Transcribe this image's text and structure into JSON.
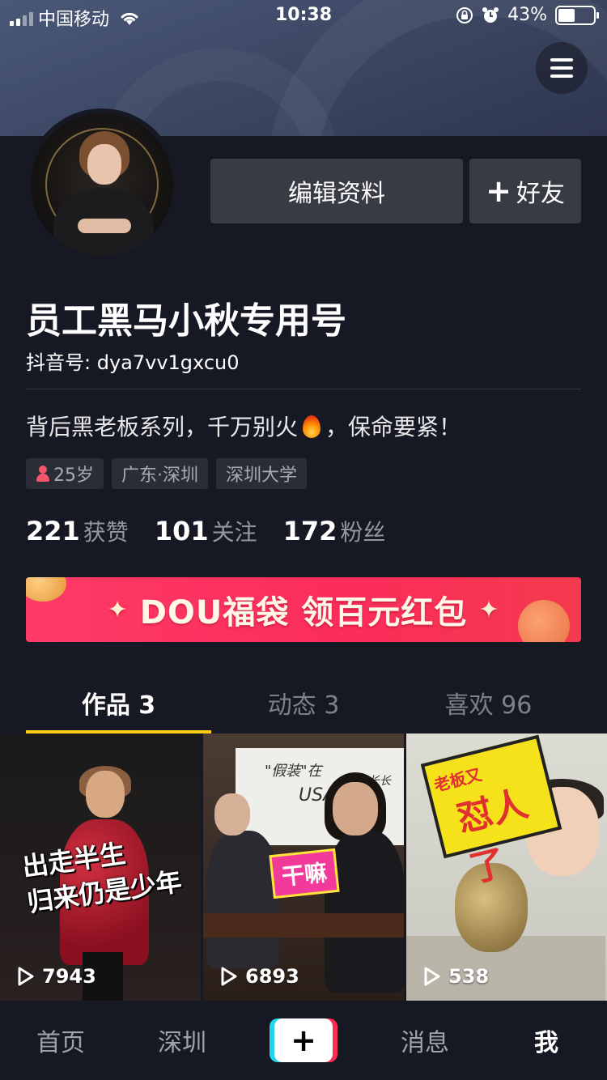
{
  "status_bar": {
    "carrier": "中国移动",
    "time": "10:38",
    "battery_percent": "43%",
    "battery_level": 0.43
  },
  "profile": {
    "edit_label": "编辑资料",
    "add_friend_label": "好友",
    "name": "员工黑马小秋专用号",
    "douyin_id": "抖音号: dya7vv1gxcu0",
    "bio_before": "背后黑老板系列，千万别火",
    "bio_after": "，保命要紧！",
    "tags": {
      "age": "25岁",
      "location": "广东·深圳",
      "school": "深圳大学"
    },
    "stats": {
      "likes_num": "221",
      "likes_label": "获赞",
      "following_num": "101",
      "following_label": "关注",
      "followers_num": "172",
      "followers_label": "粉丝"
    }
  },
  "promo": {
    "text": "DOU福袋  领百元红包",
    "accent_color": "#fe2c55"
  },
  "tabs": {
    "works": "作品 3",
    "moments": "动态 3",
    "likes": "喜欢 96",
    "active_color": "#face15"
  },
  "videos": [
    {
      "plays": "7943",
      "caption_line1": "出走半生",
      "caption_line2": "归来仍是少年"
    },
    {
      "plays": "6893",
      "sticker": "干嘛",
      "board_text1": "\"假装\"在",
      "board_text2": "USA",
      "board_text3": "超长长长"
    },
    {
      "plays": "538",
      "sign_small": "老板又",
      "sign_big": "怼人了"
    }
  ],
  "nav": {
    "home": "首页",
    "city": "深圳",
    "create": "+",
    "messages": "消息",
    "me": "我"
  },
  "icons": {
    "signal": "signal-icon",
    "wifi": "wifi-icon",
    "orientation_lock": "orientation-lock-icon",
    "alarm": "alarm-icon",
    "battery": "battery-icon",
    "menu": "hamburger-menu-icon",
    "fire": "fire-emoji-icon",
    "female": "female-icon",
    "play": "play-outline-icon"
  }
}
